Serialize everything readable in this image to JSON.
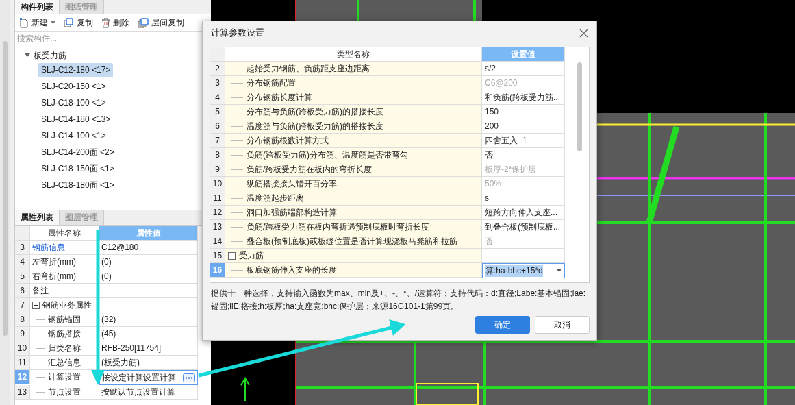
{
  "component_panel": {
    "tabs": [
      {
        "label": "构件列表",
        "selected": true
      },
      {
        "label": "图纸管理",
        "selected": false
      }
    ],
    "toolbar": [
      {
        "label": "新建",
        "kind": "new",
        "dropdown": true
      },
      {
        "label": "复制",
        "kind": "copy",
        "dropdown": false
      },
      {
        "label": "删除",
        "kind": "delete",
        "dropdown": false
      },
      {
        "label": "层间复制",
        "kind": "floor-copy",
        "dropdown": false
      }
    ],
    "search": {
      "placeholder": "搜索构件..."
    },
    "tree": {
      "label": "板受力筋",
      "expanded": true,
      "children": [
        {
          "label": "SLJ-C12-180 <17>",
          "selected": true
        },
        {
          "label": "SLJ-C20-150 <1>",
          "selected": false
        },
        {
          "label": "SLJ-C18-100 <1>",
          "selected": false
        },
        {
          "label": "SLJ-C14-180 <13>",
          "selected": false
        },
        {
          "label": "SLJ-C14-100 <1>",
          "selected": false
        },
        {
          "label": "SLJ-C14-200面 <2>",
          "selected": false
        },
        {
          "label": "SLJ-C18-150面 <1>",
          "selected": false
        },
        {
          "label": "SLJ-C18-180面 <1>",
          "selected": false
        }
      ]
    }
  },
  "property_panel": {
    "tabs": [
      {
        "label": "属性列表",
        "selected": true
      },
      {
        "label": "图层管理",
        "selected": false
      }
    ],
    "columns": [
      "属性名称",
      "属性值"
    ],
    "rows": [
      {
        "number": "3",
        "kind": "link",
        "name": "钢筋信息",
        "value": "C12@180",
        "selected": false
      },
      {
        "number": "4",
        "kind": "plain",
        "name": "左弯折(mm)",
        "value": "(0)",
        "selected": false
      },
      {
        "number": "5",
        "kind": "plain",
        "name": "右弯折(mm)",
        "value": "(0)",
        "selected": false
      },
      {
        "number": "6",
        "kind": "plain",
        "name": "备注",
        "selected": false
      },
      {
        "number": "7",
        "kind": "group",
        "name": "钢筋业务属性",
        "expanded": true,
        "selected": false
      },
      {
        "number": "8",
        "kind": "child",
        "name": "钢筋锚固",
        "value": "(32)",
        "selected": false
      },
      {
        "number": "9",
        "kind": "child",
        "name": "钢筋搭接",
        "value": "(45)",
        "selected": false
      },
      {
        "number": "10",
        "kind": "child",
        "name": "归类名称",
        "value": "RFB-250[11754]",
        "selected": false
      },
      {
        "number": "11",
        "kind": "child",
        "name": "汇总信息",
        "value": "(板受力筋)",
        "selected": false
      },
      {
        "number": "12",
        "kind": "child",
        "name": "计算设置",
        "value": "按设定计算设置计算",
        "selected": true
      },
      {
        "number": "13",
        "kind": "child",
        "name": "节点设置",
        "value": "按默认节点设置计算",
        "selected": false
      }
    ]
  },
  "dialog": {
    "title": "计算参数设置",
    "columns": [
      "类型名称",
      "设置值"
    ],
    "rows": [
      {
        "number": "2",
        "kind": "item",
        "name": "起始受力钢筋、负筋距支座边距离",
        "value": "s/2",
        "disabled": false,
        "selected": false
      },
      {
        "number": "3",
        "kind": "item",
        "name": "分布钢筋配置",
        "value": "C6@200",
        "disabled": true,
        "selected": false
      },
      {
        "number": "4",
        "kind": "item",
        "name": "分布钢筋长度计算",
        "value": "和负筋(跨板受力筋...",
        "disabled": false,
        "selected": false
      },
      {
        "number": "5",
        "kind": "item",
        "name": "分布筋与负筋(跨板受力筋)的搭接长度",
        "value": "150",
        "disabled": false,
        "selected": false
      },
      {
        "number": "6",
        "kind": "item",
        "name": "温度筋与负筋(跨板受力筋)的搭接长度",
        "value": "200",
        "disabled": false,
        "selected": false
      },
      {
        "number": "7",
        "kind": "item",
        "name": "分布钢筋根数计算方式",
        "value": "四舍五入+1",
        "disabled": false,
        "selected": false
      },
      {
        "number": "8",
        "kind": "item",
        "name": "负筋(跨板受力筋)分布筋、温度筋是否带弯勾",
        "value": "否",
        "disabled": false,
        "selected": false
      },
      {
        "number": "9",
        "kind": "item",
        "name": "负筋/跨板受力筋在板内的弯折长度",
        "value": "板厚-2*保护层",
        "disabled": true,
        "selected": false
      },
      {
        "number": "10",
        "kind": "item",
        "name": "纵筋搭接接头错开百分率",
        "value": "50%",
        "disabled": true,
        "selected": false
      },
      {
        "number": "11",
        "kind": "item",
        "name": "温度筋起步距离",
        "value": "s",
        "disabled": false,
        "selected": false
      },
      {
        "number": "12",
        "kind": "item",
        "name": "洞口加强筋端部构造计算",
        "value": "短跨方向伸入支座...",
        "disabled": false,
        "selected": false
      },
      {
        "number": "13",
        "kind": "item",
        "name": "负筋/跨板受力筋在板内弯折遇预制底板时弯折长度",
        "value": "到叠合板(预制底板...",
        "disabled": false,
        "selected": false
      },
      {
        "number": "14",
        "kind": "item",
        "name": "叠合板(预制底板)或板缝位置是否计算现浇板马凳筋和拉筋",
        "value": "否",
        "disabled": true,
        "selected": false
      },
      {
        "number": "15",
        "kind": "group",
        "name": "受力筋",
        "expanded": true,
        "selected": false
      },
      {
        "number": "16",
        "kind": "item",
        "name": "板底钢筋伸入支座的长度",
        "value": "算:ha-bhc+15*d",
        "disabled": false,
        "selected": true
      }
    ],
    "description": "提供十一种选择，支持输入函数为max、min及+、-、*、/运算符；支持代码：d:直径;Labe:基本锚固;lae:锚固;llE:搭接;h:板厚;ha:支座宽;bhc:保护层；来源16G101-1第99页。",
    "buttons": [
      {
        "label": "确定",
        "primary": true
      },
      {
        "label": "取消",
        "primary": false
      }
    ]
  }
}
